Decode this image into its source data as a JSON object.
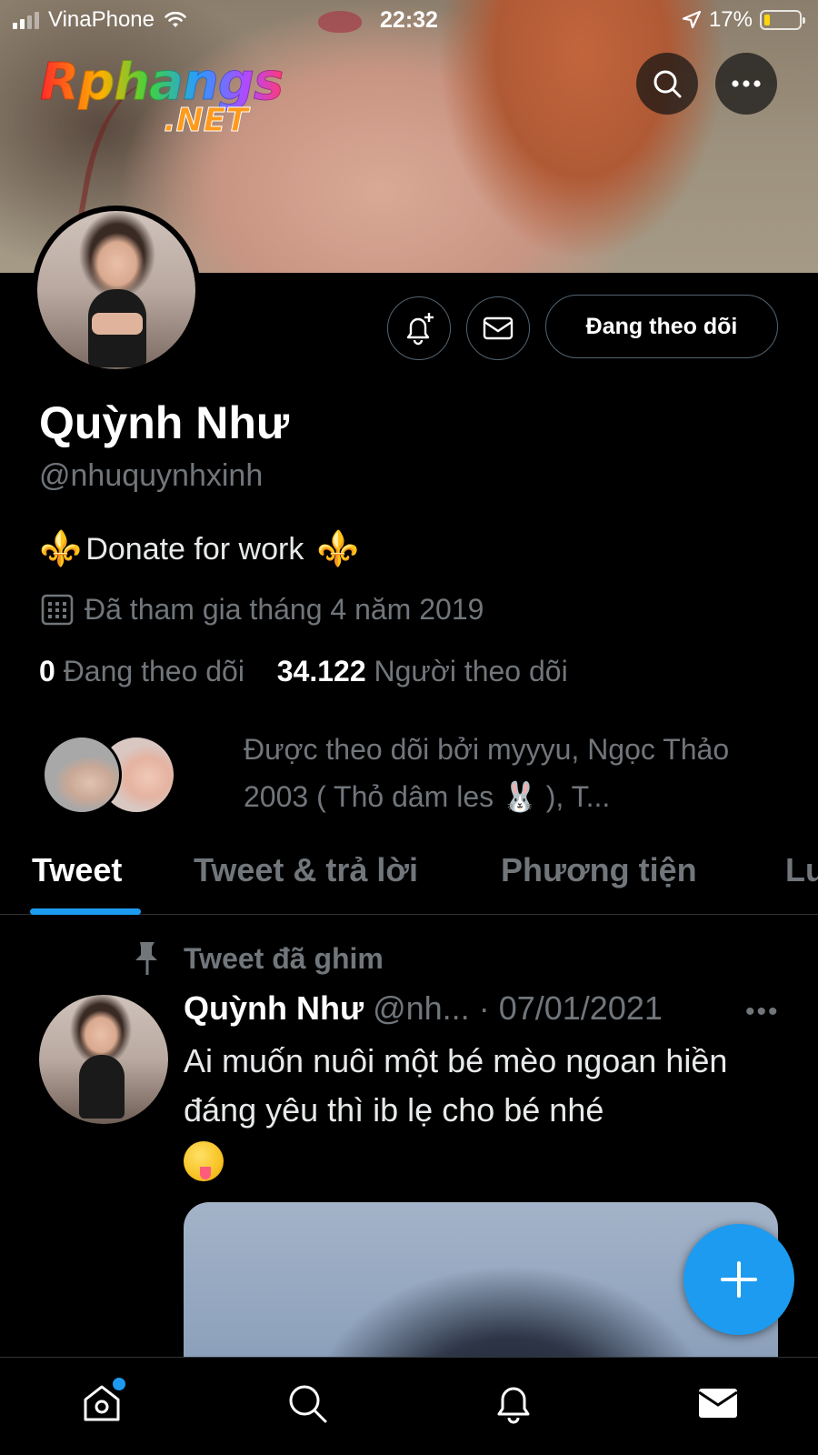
{
  "status_bar": {
    "carrier": "VinaPhone",
    "time": "22:32",
    "battery_percent": "17%",
    "battery_level": 0.17,
    "icons": [
      "signal-icon",
      "wifi-icon",
      "location-arrow-icon",
      "battery-icon"
    ]
  },
  "watermark": {
    "main": "Rphangs",
    "sub": ".NET"
  },
  "header": {
    "search_icon": "search-icon",
    "more_icon": "more-options-icon"
  },
  "profile": {
    "name": "Quỳnh Như",
    "handle": "@nhuquynhxinh",
    "bio": "Donate for work",
    "bio_emoji_left": "⚜️",
    "bio_emoji_right": "⚜️",
    "joined": "Đã tham gia tháng 4 năm 2019",
    "following_count": "0",
    "following_label": "Đang theo dõi",
    "followers_count": "34.122",
    "followers_label": "Người theo dõi",
    "followed_by": "Được theo dõi bởi myyyu, Ngọc Thảo 2003 ( Thỏ dâm les 🐰 ), T..."
  },
  "actions": {
    "follow_label": "Đang theo dõi",
    "notify_icon": "bell-plus-icon",
    "message_icon": "mail-icon"
  },
  "tabs": [
    {
      "label": "Tweet",
      "active": true
    },
    {
      "label": "Tweet & trả lời",
      "active": false
    },
    {
      "label": "Phương tiện",
      "active": false
    },
    {
      "label": "Lư",
      "active": false
    }
  ],
  "pinned_tweet": {
    "pin_label": "Tweet đã ghim",
    "author_name": "Quỳnh Như",
    "author_handle": "@nh...",
    "separator": "·",
    "date": "07/01/2021",
    "text": "Ai muốn nuôi một bé mèo ngoan hiền đáng yêu thì ib lẹ cho bé nhé",
    "text_emoji": "😜"
  },
  "bottom_nav": [
    {
      "icon": "home-icon",
      "has_notification": true
    },
    {
      "icon": "search-icon",
      "has_notification": false
    },
    {
      "icon": "bell-icon",
      "has_notification": false
    },
    {
      "icon": "mail-icon",
      "has_notification": false
    }
  ],
  "colors": {
    "accent": "#1d9bf0",
    "secondary_text": "#71767b",
    "border": "#2f3336",
    "battery_low": "#ffd60a"
  }
}
